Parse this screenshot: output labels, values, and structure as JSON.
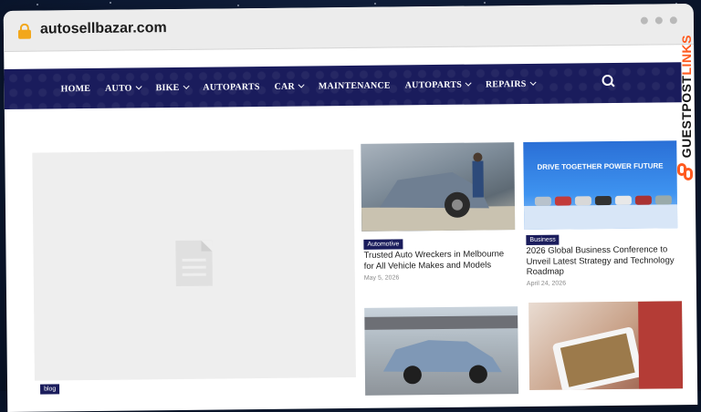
{
  "browser": {
    "url": "autosellbazar.com"
  },
  "nav": {
    "items": [
      {
        "label": "HOME",
        "dropdown": false
      },
      {
        "label": "AUTO",
        "dropdown": true
      },
      {
        "label": "BIKE",
        "dropdown": true
      },
      {
        "label": "AUTOPARTS",
        "dropdown": false
      },
      {
        "label": "CAR",
        "dropdown": true
      },
      {
        "label": "MAINTENANCE",
        "dropdown": false
      },
      {
        "label": "AUTOPARTS",
        "dropdown": true
      },
      {
        "label": "REPAIRS",
        "dropdown": true
      }
    ],
    "search_icon": "search-icon",
    "background": "#1a1c5c"
  },
  "featured": {
    "badge": "blog"
  },
  "posts": [
    {
      "category": "Automotive",
      "title": "Trusted Auto Wreckers in Melbourne for All Vehicle Makes and Models",
      "date": "May 5, 2026"
    },
    {
      "category": "Business",
      "title": "2026 Global Business Conference to Unveil Latest Strategy and Technology Roadmap",
      "date": "April 24, 2026",
      "banner_text": "DRIVE TOGETHER POWER FUTURE"
    },
    {},
    {}
  ],
  "watermark": {
    "text_main": "GUESTPOST",
    "text_accent": "LINKS"
  },
  "colors": {
    "accent": "#1a1c5c",
    "brand_orange": "#ff5a1f",
    "lock": "#f2a71b"
  }
}
